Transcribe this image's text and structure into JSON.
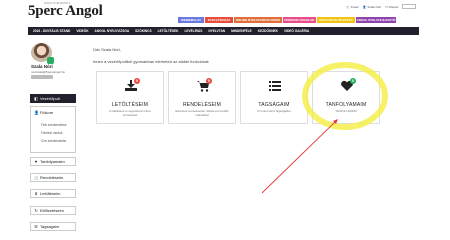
{
  "header": {
    "logo": "5perc Angol",
    "logo_sub": "ANGOL NYELVKÖNYV",
    "links": [
      "Kosár",
      "Szala Nóri",
      "Kilépés"
    ]
  },
  "colorbar": [
    {
      "label": "WEBBIRALAT",
      "color": "#6c7ae0",
      "width": 26
    },
    {
      "label": "NYELVÁRUHÁZ",
      "color": "#e74c3c",
      "width": 28
    },
    {
      "label": "ONLINE NYELVTANFOLYAMOK",
      "color": "#e0703a",
      "width": 48
    },
    {
      "label": "PRÉMIUM ANGOLOK",
      "color": "#e84c8a",
      "width": 33
    },
    {
      "label": "MAGAZIN ELŐFIZETÉS",
      "color": "#f1c40f",
      "width": 38
    },
    {
      "label": "ANGOL NYELVFEJLESZTŐ",
      "color": "#8e44ad",
      "width": 40
    }
  ],
  "nav": [
    "2016 - DIGITÁLIS STAND",
    "VIDEÓK",
    "ANGOL NYELVVIZSGA",
    "SZÓKINCS",
    "LETÖLTÉSEK",
    "LEVÉLÍRÁS",
    "NYELVTAN",
    "MINDENFÉLE",
    "KEZDŐKNEK",
    "VIDEÓ GALÉRIA"
  ],
  "user": {
    "name": "Szala Nóri",
    "email": "noriszala@5percangol.hu"
  },
  "sidebar": {
    "dashboard": "Vezérlőpult",
    "fiokom": "Fiókom",
    "sub": [
      "Fiók szerkesztése",
      "Fizetési módok",
      "Cím szerkesztése"
    ],
    "items": [
      "Tanfolyamaim",
      "Rendeléseim",
      "Letöltéseim",
      "Előfizetéseim",
      "Tagságaim"
    ]
  },
  "main": {
    "greeting": "Üdv Szala Nóri,",
    "intro": "Innen a vezérlőpultból gyorsabban elérheted az alábbi funkciókat:",
    "cards": [
      {
        "title": "LETÖLTÉSEIM",
        "desc": "Itt találhatod a megvásárolt online termékeidet",
        "badge": "0",
        "badge_color": "#e74c3c",
        "icon": "download-icon"
      },
      {
        "title": "RENDELÉSEIM",
        "desc": "Elérheted rendeléseidet, láthatod a korábbi számláidat",
        "badge": "0",
        "badge_color": "#e74c3c",
        "icon": "cart-icon"
      },
      {
        "title": "TAGSÁGAIM",
        "desc": "Itt tudod elérni tagságaidat",
        "badge": "",
        "badge_color": "#e74c3c",
        "icon": "list-icon"
      },
      {
        "title": "TANFOLYAMAIM",
        "desc": "TANFOLYAMAIM",
        "badge": "0",
        "badge_color": "#27ae60",
        "icon": "heart-icon"
      }
    ]
  }
}
